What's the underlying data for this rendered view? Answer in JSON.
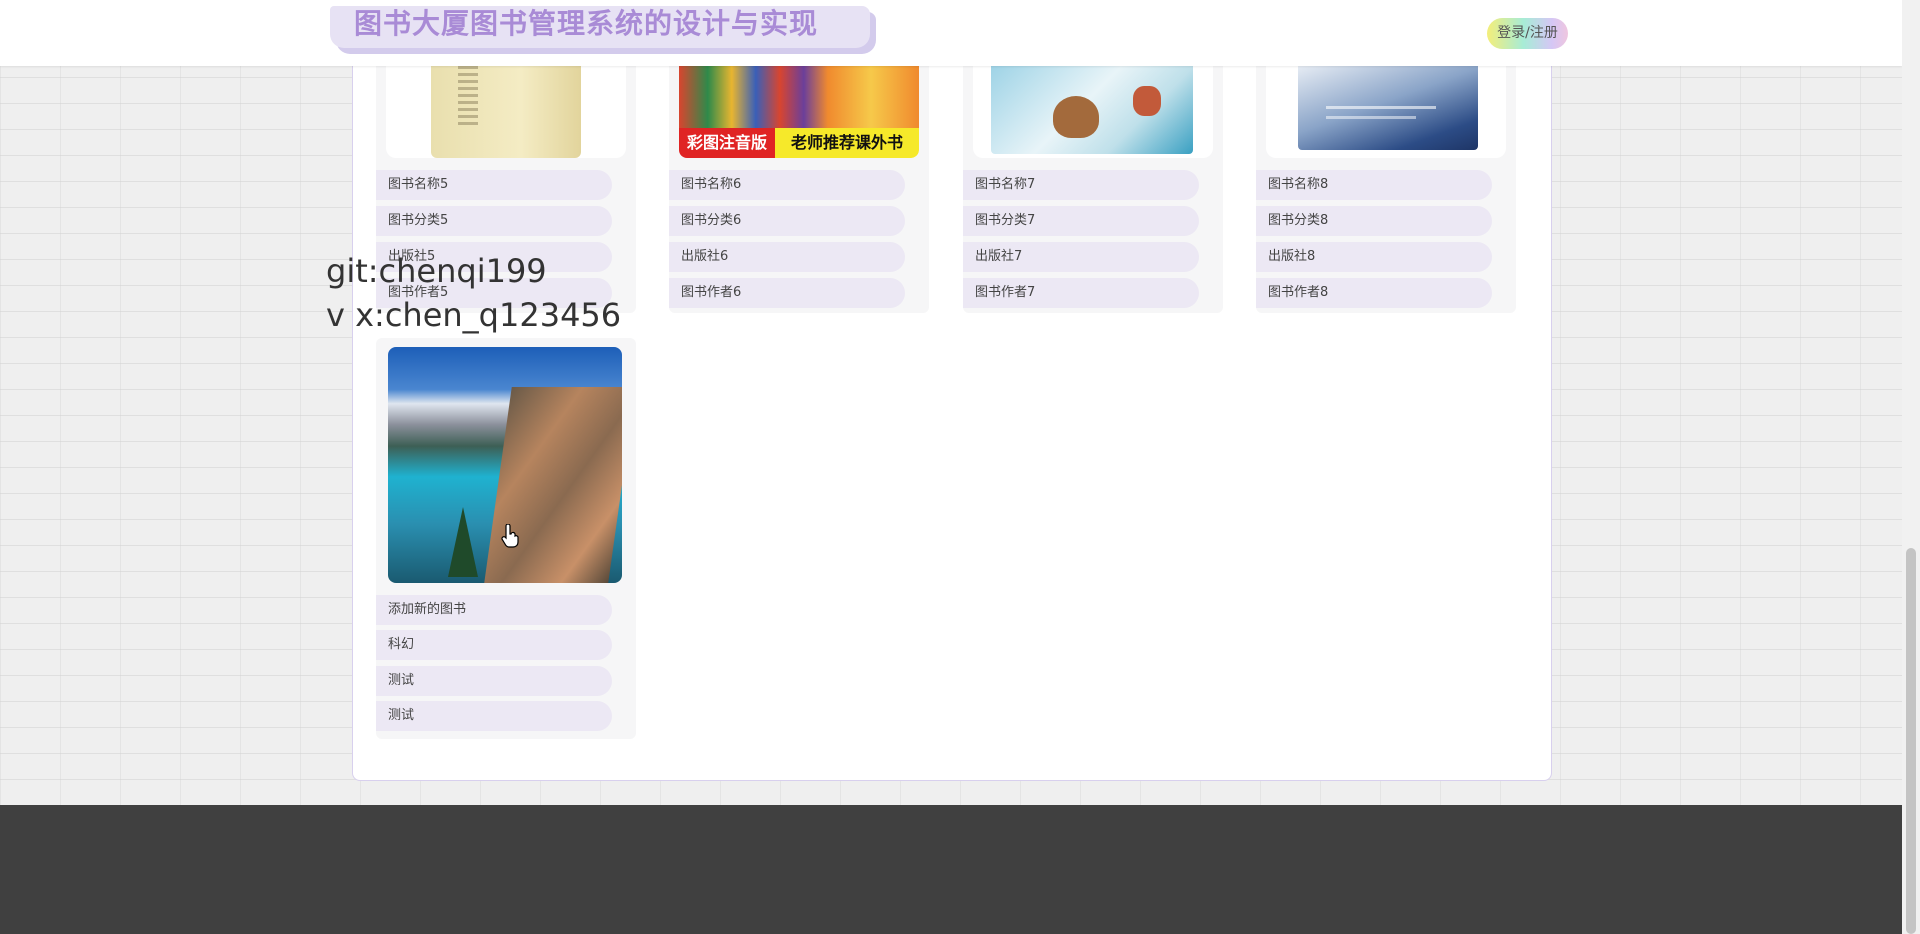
{
  "header": {
    "title": "图书大厦图书管理系统的设计与实现",
    "login_label": "登录/注册"
  },
  "overlay": {
    "line1": "git:chenqi199",
    "line2": "v x:chen_q123456"
  },
  "books": [
    {
      "name": "图书名称5",
      "category": "图书分类5",
      "publisher": "出版社5",
      "author": "图书作者5"
    },
    {
      "name": "图书名称6",
      "category": "图书分类6",
      "publisher": "出版社6",
      "author": "图书作者6",
      "cover_badge_left": "彩图注音版",
      "cover_badge_right": "老师推荐课外书"
    },
    {
      "name": "图书名称7",
      "category": "图书分类7",
      "publisher": "出版社7",
      "author": "图书作者7"
    },
    {
      "name": "图书名称8",
      "category": "图书分类8",
      "publisher": "出版社8",
      "author": "图书作者8"
    },
    {
      "name": "添加新的图书",
      "category": "科幻",
      "publisher": "测试",
      "author": "测试"
    }
  ],
  "colors": {
    "title_text": "#a98bd6",
    "title_bg": "#e7e2f4",
    "field_bg": "#ece8f4",
    "footer_bg": "#404040"
  }
}
